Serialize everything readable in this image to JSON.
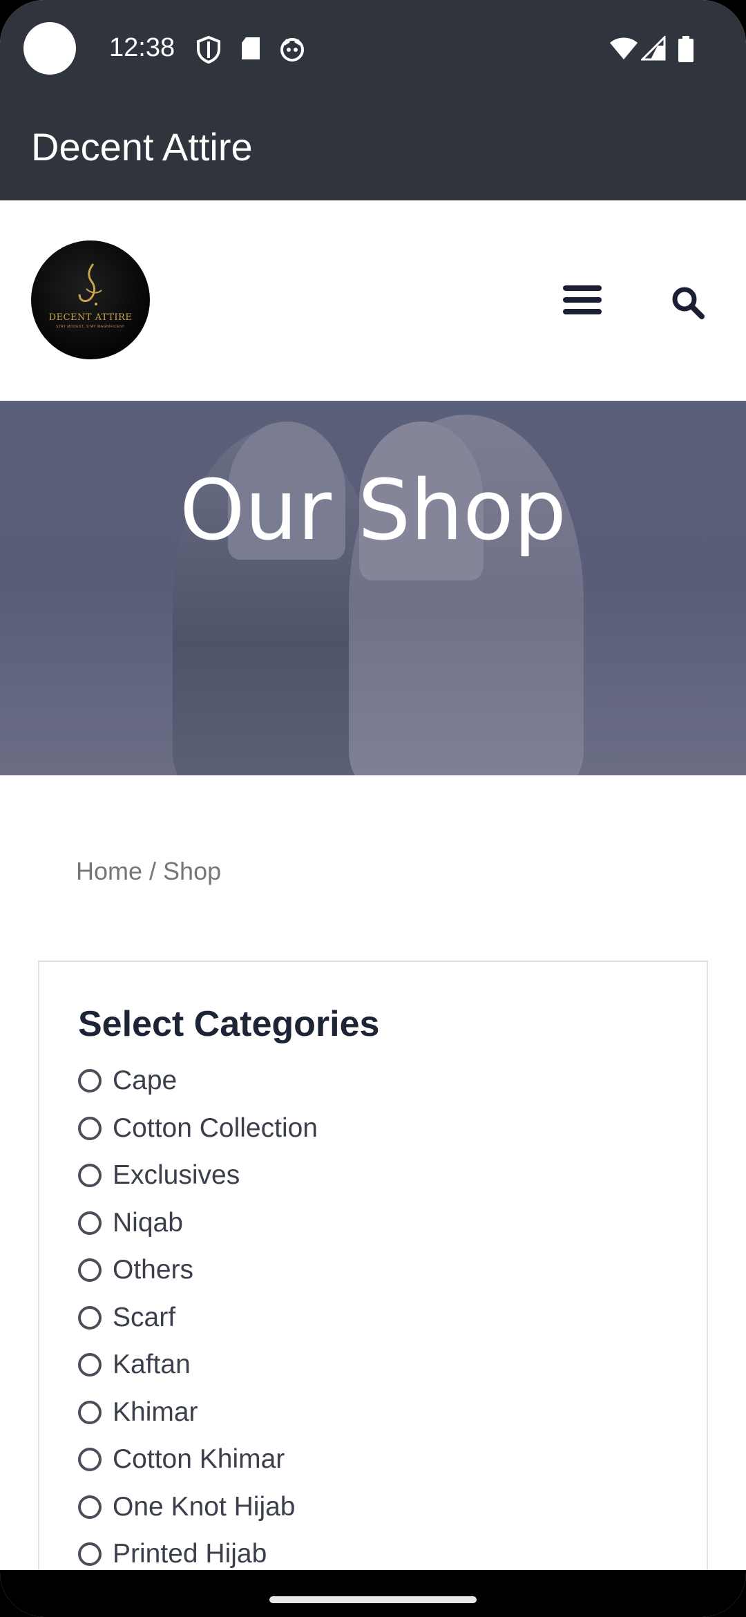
{
  "status_bar": {
    "time": "12:38",
    "left_icons": [
      "shield-icon",
      "sd-card-icon",
      "cat-face-icon"
    ],
    "right_icons": [
      "wifi-icon",
      "signal-icon",
      "battery-icon"
    ]
  },
  "app_bar": {
    "title": "Decent Attire"
  },
  "header": {
    "logo_text": "DECENT ATTIRE",
    "logo_subtext": "STAY MODEST, STAY MAGNIFICENT",
    "menu_icon": "hamburger-menu-icon",
    "search_icon": "search-icon"
  },
  "hero": {
    "title": "Our Shop"
  },
  "breadcrumb": {
    "home": "Home",
    "separator": " / ",
    "current": "Shop"
  },
  "categories": {
    "heading": "Select Categories",
    "items": [
      {
        "label": "Cape"
      },
      {
        "label": "Cotton Collection"
      },
      {
        "label": "Exclusives"
      },
      {
        "label": "Niqab"
      },
      {
        "label": "Others"
      },
      {
        "label": "Scarf"
      },
      {
        "label": "Kaftan"
      },
      {
        "label": "Khimar"
      },
      {
        "label": "Cotton Khimar"
      },
      {
        "label": "One Knot Hijab"
      },
      {
        "label": "Printed Hijab"
      }
    ]
  },
  "colors": {
    "app_bar": "#30353d",
    "hero_overlay": "#5a5f7a",
    "heading": "#1c2436",
    "logo_gold": "#c9a24a"
  }
}
